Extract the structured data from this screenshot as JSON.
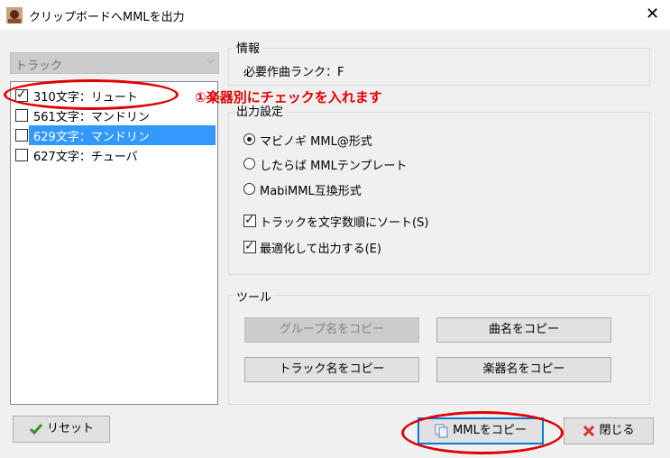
{
  "window": {
    "title": "クリップボードへMMLを出力",
    "close_glyph": "✕"
  },
  "track_combo": {
    "value": "トラック",
    "arrow": "⌵"
  },
  "tracks": [
    {
      "label": "310文字：リュート",
      "checked": true,
      "selected": false
    },
    {
      "label": "561文字：マンドリン",
      "checked": false,
      "selected": false
    },
    {
      "label": "629文字：マンドリン",
      "checked": false,
      "selected": true
    },
    {
      "label": "627文字：チューバ",
      "checked": false,
      "selected": false
    }
  ],
  "info": {
    "title": "情報",
    "rank_text": "必要作曲ランク：F"
  },
  "output": {
    "title": "出力設定",
    "format_options": [
      {
        "label": "マビノギ MML@形式",
        "selected": true
      },
      {
        "label": "したらば MMLテンプレート",
        "selected": false
      },
      {
        "label": "MabiMML互換形式",
        "selected": false
      }
    ],
    "check_options": [
      {
        "label": "トラックを文字数順にソート(S)",
        "checked": true
      },
      {
        "label": "最適化して出力する(E)",
        "checked": true
      }
    ]
  },
  "tools": {
    "title": "ツール",
    "group_name_copy": "グループ名をコピー",
    "song_name_copy": "曲名をコピー",
    "track_name_copy": "トラック名をコピー",
    "instrument_name_copy": "楽器名をコピー"
  },
  "footer": {
    "reset_label": "リセット",
    "copy_mml_label": "MMLをコピー",
    "close_label": "閉じる"
  },
  "annotation": {
    "text": "①楽器別にチェックを入れます",
    "color": "#e00000"
  },
  "check_glyph": "✓"
}
